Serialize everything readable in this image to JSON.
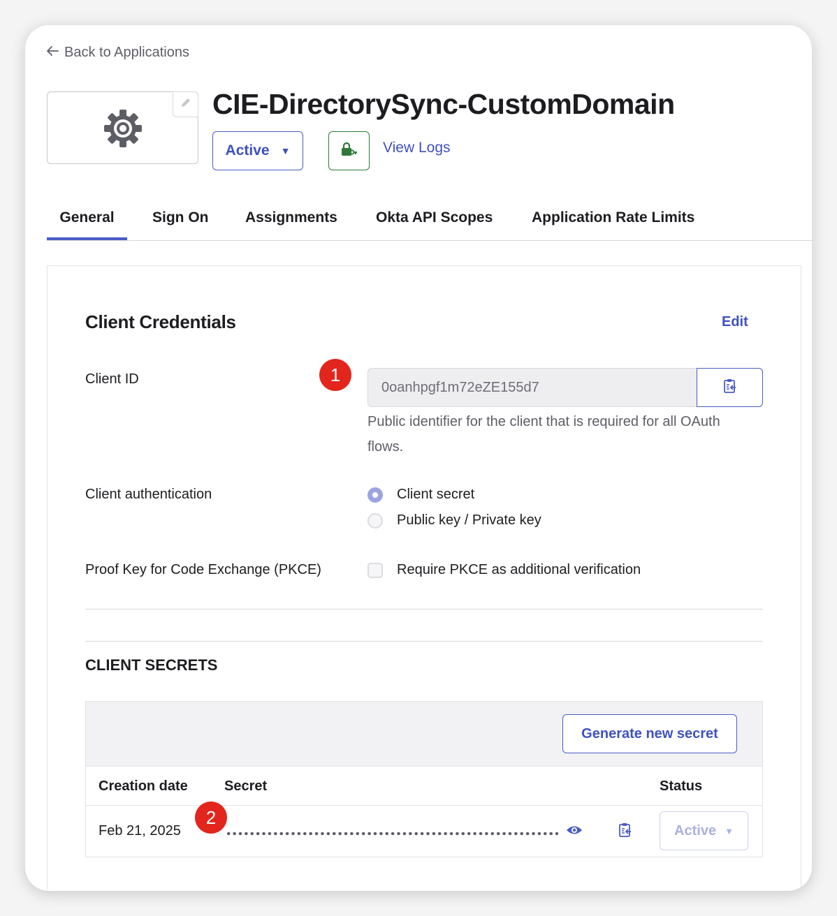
{
  "nav": {
    "back_label": "Back to Applications"
  },
  "app": {
    "title": "CIE-DirectorySync-CustomDomain",
    "status": "Active",
    "view_logs_label": "View Logs"
  },
  "tabs": [
    {
      "label": "General",
      "active": true
    },
    {
      "label": "Sign On"
    },
    {
      "label": "Assignments"
    },
    {
      "label": "Okta API Scopes"
    },
    {
      "label": "Application Rate Limits"
    }
  ],
  "credentials": {
    "heading": "Client Credentials",
    "edit_label": "Edit",
    "client_id_label": "Client ID",
    "client_id_value": "0oanhpgf1m72eZE155d7",
    "client_id_help": "Public identifier for the client that is required for all OAuth flows.",
    "auth_label": "Client authentication",
    "auth_options": [
      {
        "label": "Client secret",
        "selected": true
      },
      {
        "label": "Public key / Private key",
        "selected": false
      }
    ],
    "pkce_label": "Proof Key for Code Exchange (PKCE)",
    "pkce_option": "Require PKCE as additional verification",
    "pkce_checked": false
  },
  "secrets": {
    "heading": "CLIENT SECRETS",
    "generate_label": "Generate new secret",
    "columns": [
      "Creation date",
      "Secret",
      "Status"
    ],
    "rows": [
      {
        "creation_date": "Feb 21, 2025",
        "status": "Active"
      }
    ]
  },
  "annotations": [
    "1",
    "2"
  ],
  "colors": {
    "accent": "#4a5bc7",
    "success": "#2f7a3b",
    "annotation": "#e3261d"
  },
  "icons": [
    "arrow-left-icon",
    "pencil-icon",
    "gear-icon",
    "lock-key-icon",
    "clipboard-icon",
    "eye-icon",
    "caret-down-icon"
  ]
}
